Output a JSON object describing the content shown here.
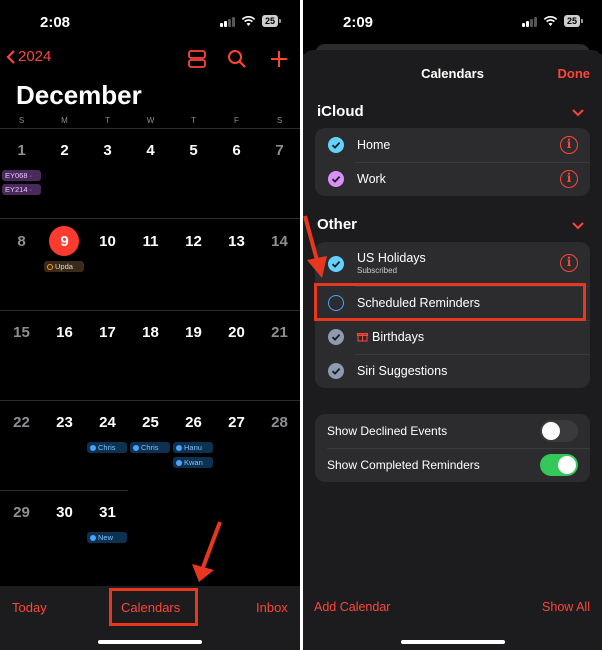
{
  "left_screen": {
    "status": {
      "time": "2:08",
      "battery": "25"
    },
    "nav": {
      "back_label": "2024"
    },
    "month_title": "December",
    "weekdays": [
      "S",
      "M",
      "T",
      "W",
      "T",
      "F",
      "S"
    ],
    "weeks": [
      {
        "days": [
          "1",
          "2",
          "3",
          "4",
          "5",
          "6",
          "7"
        ]
      },
      {
        "days": [
          "8",
          "9",
          "10",
          "11",
          "12",
          "13",
          "14"
        ]
      },
      {
        "days": [
          "15",
          "16",
          "17",
          "18",
          "19",
          "20",
          "21"
        ]
      },
      {
        "days": [
          "22",
          "23",
          "24",
          "25",
          "26",
          "27",
          "28"
        ]
      },
      {
        "days": [
          "29",
          "30",
          "31",
          "",
          "",
          "",
          ""
        ]
      }
    ],
    "today": "9",
    "events": {
      "ey068": "EY068 ·",
      "ey214": "EY214 ·",
      "upda": "Upda",
      "chris_24": "Chris",
      "chris_25": "Chris",
      "hana": "Hanu",
      "kwan": "Kwan",
      "new": "New"
    },
    "bottom": {
      "today_label": "Today",
      "calendars_label": "Calendars",
      "inbox_label": "Inbox"
    }
  },
  "right_screen": {
    "status": {
      "time": "2:09",
      "battery": "25"
    },
    "title": "Calendars",
    "done_label": "Done",
    "icloud": {
      "header": "iCloud",
      "items": [
        {
          "label": "Home",
          "color": "#64d2ff",
          "checked": true
        },
        {
          "label": "Work",
          "color": "#da8fff",
          "checked": true
        }
      ]
    },
    "other": {
      "header": "Other",
      "items": [
        {
          "label": "US Holidays",
          "sub": "Subscribed",
          "color": "#64d2ff",
          "checked": true
        },
        {
          "label": "Scheduled Reminders",
          "color": "#4aa3ff",
          "checked": false
        },
        {
          "label": "Birthdays",
          "color": "#8e9ab0",
          "checked": true
        },
        {
          "label": "Siri Suggestions",
          "color": "#8e9ab0",
          "checked": true
        }
      ]
    },
    "toggles": [
      {
        "label": "Show Declined Events",
        "on": false
      },
      {
        "label": "Show Completed Reminders",
        "on": true
      }
    ],
    "footer": {
      "add_label": "Add Calendar",
      "show_all_label": "Show All"
    }
  },
  "colors": {
    "accent": "#ff453a",
    "toggle_on": "#34c759",
    "highlight": "#e8371f"
  }
}
